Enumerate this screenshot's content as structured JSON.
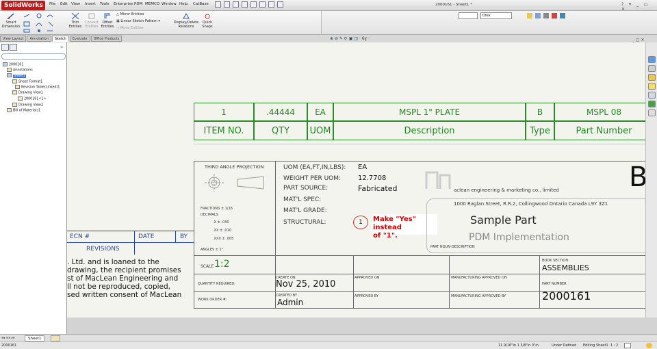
{
  "app": {
    "brand": "SolidWorks",
    "doc_title": "2000161 - Sheet1 *",
    "menu": [
      "File",
      "Edit",
      "View",
      "Insert",
      "Tools",
      "Enterprise PDM",
      "MEMCO",
      "Window",
      "Help",
      "CatBase"
    ],
    "window_controls": "? ▾ _ ▢ ✕",
    "doc_combo_value": "Dtex"
  },
  "ribbon": {
    "smart_dimension": "Smart Dimension",
    "trim_entities": "Trim Entities",
    "convert_entities": "Convert Entities",
    "offset_entities": "Offset Entities",
    "mirror_entities": "Mirror Entities",
    "linear_sketch_pattern": "Linear Sketch Pattern",
    "move_entities": "Move Entities",
    "display_delete_relations": "Display/Delete Relations",
    "quick_snaps": "Quick Snaps"
  },
  "tabs": [
    "View Layout",
    "Annotation",
    "Sketch",
    "Evaluate",
    "Office Products"
  ],
  "active_tab": "Sketch",
  "tree": {
    "root": "2000161",
    "items": [
      {
        "label": "Annotations",
        "indent": 1
      },
      {
        "label": "Sheet1",
        "indent": 1,
        "selected": true
      },
      {
        "label": "Sheet Format1",
        "indent": 2
      },
      {
        "label": "Revision Table(Linked)1",
        "indent": 2
      },
      {
        "label": "Drawing View1",
        "indent": 2
      },
      {
        "label": "2000161<1>",
        "indent": 3
      },
      {
        "label": "Drawing View2",
        "indent": 2
      },
      {
        "label": "Bill of Materials1",
        "indent": 1
      }
    ]
  },
  "bom": {
    "row": [
      "1",
      ".44444",
      "EA",
      "MSPL 1\" PLATE",
      "B",
      "MSPL 08"
    ],
    "headers": [
      "ITEM NO.",
      "QTY",
      "UOM",
      "Description",
      "Type",
      "Part Number"
    ]
  },
  "revisions": {
    "ecn": "ECN #",
    "date": "DATE",
    "by": "BY",
    "title": "REVISIONS"
  },
  "notice_text": [
    ". Ltd. and is loaned to the",
    "drawing, the recipient promises",
    "st of MacLean Engineering and",
    "ll not be reproduced, copied,",
    "sed written consent of MacLean"
  ],
  "title_block": {
    "projection": "THIRD ANGLE PROJECTION",
    "tolerances": [
      "FRACTIONS ± 1/16",
      "DECIMALS",
      ".X  ± .030",
      ".XX  ± .010",
      ".XXX ± .005",
      "ANGLES ± 1°"
    ],
    "uom_label": "UOM (EA,FT,IN,LBS):",
    "uom_value": "EA",
    "weight_label": "WEIGHT PER UOM:",
    "weight_value": "12.7708",
    "source_label": "PART SOURCE:",
    "source_value": "Fabricated",
    "mat_spec_label": "MAT'L SPEC:",
    "mat_grade_label": "MAT'L GRADE:",
    "structural_label": "STRUCTURAL:",
    "structural_value": "1",
    "note": [
      "Make \"Yes\" instead",
      "of \"1\"."
    ],
    "company": "aclean engineering & marketing co., limited",
    "address": "1000 Raglan Street, R.R.2, Collingwood Ontario Canada L9Y 3Z1",
    "part_name": "Sample Part",
    "part_desc": "PDM   Implementation",
    "noun_desc_label": "PART NOUN-DESCRIPTION",
    "size_letter": "B",
    "scale_label": "SCALE",
    "scale_value": "1:2",
    "create_on_label": "CREATE ON",
    "create_on_value": "Nov 25, 2010",
    "approved_on_label": "APPROVED ON",
    "mfg_approved_on_label": "MANUFACTURING APPROVED ON",
    "book_section_label": "BOOK SECTION",
    "book_section_value": "ASSEMBLIES",
    "qty_required_label": "QUANTITY REQUIRED:",
    "part_number_label": "PART NUMBER",
    "part_number_value": "2000161",
    "work_order_label": "WORK ORDER #:",
    "created_by_label": "CREATED BY",
    "created_by_value": "Admin",
    "approved_by_label": "APPROVED BY",
    "mfg_approved_by_label": "MANUFACTURING APPROVED BY"
  },
  "sheet_tab": "Sheet1",
  "status": {
    "left": "2000161",
    "coords": "11 9/16\"in    1 3/8\"in    0\"in",
    "state": "Under Defined",
    "editing": "Editing Sheet1",
    "scale": "1 : 2"
  },
  "colors": {
    "accent": "#1d8a1d",
    "revision_blue": "#2244aa",
    "note_red": "#cc0000"
  }
}
